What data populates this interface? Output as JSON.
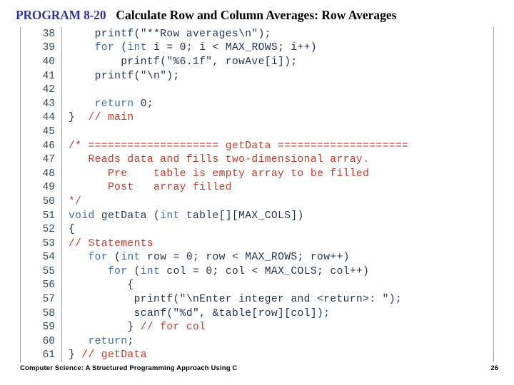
{
  "title": {
    "program_label": "PROGRAM 8-20",
    "program_title": "Calculate Row and Column Averages: Row Averages"
  },
  "colors": {
    "program_label": "#333399",
    "keyword": "#3b6ab5",
    "comment": "#c0392b",
    "code_text": "#1f3350",
    "lineno": "#2f4a5c",
    "rule": "#9aa3ad"
  },
  "code": {
    "language": "C",
    "first_line_number": 38,
    "last_line_number": 61,
    "lines": [
      {
        "n": "38",
        "tokens": [
          {
            "t": "pl",
            "s": "    printf(\"**Row averages\\n\");"
          }
        ]
      },
      {
        "n": "39",
        "tokens": [
          {
            "t": "pl",
            "s": "    "
          },
          {
            "t": "kw",
            "s": "for"
          },
          {
            "t": "pl",
            "s": " ("
          },
          {
            "t": "kw",
            "s": "int"
          },
          {
            "t": "pl",
            "s": " i = 0; i < MAX_ROWS; i++)"
          }
        ]
      },
      {
        "n": "40",
        "tokens": [
          {
            "t": "pl",
            "s": "        printf(\"%6.1f\", rowAve[i]);"
          }
        ]
      },
      {
        "n": "41",
        "tokens": [
          {
            "t": "pl",
            "s": "    printf(\"\\n\");"
          }
        ]
      },
      {
        "n": "42",
        "tokens": [
          {
            "t": "pl",
            "s": ""
          }
        ]
      },
      {
        "n": "43",
        "tokens": [
          {
            "t": "pl",
            "s": "    "
          },
          {
            "t": "kw",
            "s": "return"
          },
          {
            "t": "pl",
            "s": " 0;"
          }
        ]
      },
      {
        "n": "44",
        "tokens": [
          {
            "t": "pl",
            "s": "} "
          },
          {
            "t": "cm",
            "s": " // main"
          }
        ]
      },
      {
        "n": "45",
        "tokens": [
          {
            "t": "pl",
            "s": ""
          }
        ]
      },
      {
        "n": "46",
        "tokens": [
          {
            "t": "cm",
            "s": "/* ==================== getData ===================="
          }
        ]
      },
      {
        "n": "47",
        "tokens": [
          {
            "t": "cm",
            "s": "   Reads data and fills two-dimensional array."
          }
        ]
      },
      {
        "n": "48",
        "tokens": [
          {
            "t": "cm",
            "s": "      Pre    table is empty array to be filled"
          }
        ]
      },
      {
        "n": "49",
        "tokens": [
          {
            "t": "cm",
            "s": "      Post   array filled"
          }
        ]
      },
      {
        "n": "50",
        "tokens": [
          {
            "t": "cm",
            "s": "*/"
          }
        ]
      },
      {
        "n": "51",
        "tokens": [
          {
            "t": "kw",
            "s": "void"
          },
          {
            "t": "pl",
            "s": " getData ("
          },
          {
            "t": "kw",
            "s": "int"
          },
          {
            "t": "pl",
            "s": " table[][MAX_COLS])"
          }
        ]
      },
      {
        "n": "52",
        "tokens": [
          {
            "t": "pl",
            "s": "{"
          }
        ]
      },
      {
        "n": "53",
        "tokens": [
          {
            "t": "cm",
            "s": "// Statements"
          }
        ]
      },
      {
        "n": "54",
        "tokens": [
          {
            "t": "pl",
            "s": "   "
          },
          {
            "t": "kw",
            "s": "for"
          },
          {
            "t": "pl",
            "s": " ("
          },
          {
            "t": "kw",
            "s": "int"
          },
          {
            "t": "pl",
            "s": " row = 0; row < MAX_ROWS; row++)"
          }
        ]
      },
      {
        "n": "55",
        "tokens": [
          {
            "t": "pl",
            "s": "      "
          },
          {
            "t": "kw",
            "s": "for"
          },
          {
            "t": "pl",
            "s": " ("
          },
          {
            "t": "kw",
            "s": "int"
          },
          {
            "t": "pl",
            "s": " col = 0; col < MAX_COLS; col++)"
          }
        ]
      },
      {
        "n": "56",
        "tokens": [
          {
            "t": "pl",
            "s": "         {"
          }
        ]
      },
      {
        "n": "57",
        "tokens": [
          {
            "t": "pl",
            "s": "          printf(\"\\nEnter integer and <return>: \");"
          }
        ]
      },
      {
        "n": "58",
        "tokens": [
          {
            "t": "pl",
            "s": "          scanf(\"%d\", &table[row][col]);"
          }
        ]
      },
      {
        "n": "59",
        "tokens": [
          {
            "t": "pl",
            "s": "         } "
          },
          {
            "t": "cm",
            "s": "// for col"
          }
        ]
      },
      {
        "n": "60",
        "tokens": [
          {
            "t": "pl",
            "s": "   "
          },
          {
            "t": "kw",
            "s": "return"
          },
          {
            "t": "pl",
            "s": ";"
          }
        ]
      },
      {
        "n": "61",
        "tokens": [
          {
            "t": "pl",
            "s": "} "
          },
          {
            "t": "cm",
            "s": "// getData"
          }
        ]
      }
    ]
  },
  "footer": {
    "book_title": "Computer Science: A Structured Programming Approach Using C",
    "page_number": "26"
  }
}
